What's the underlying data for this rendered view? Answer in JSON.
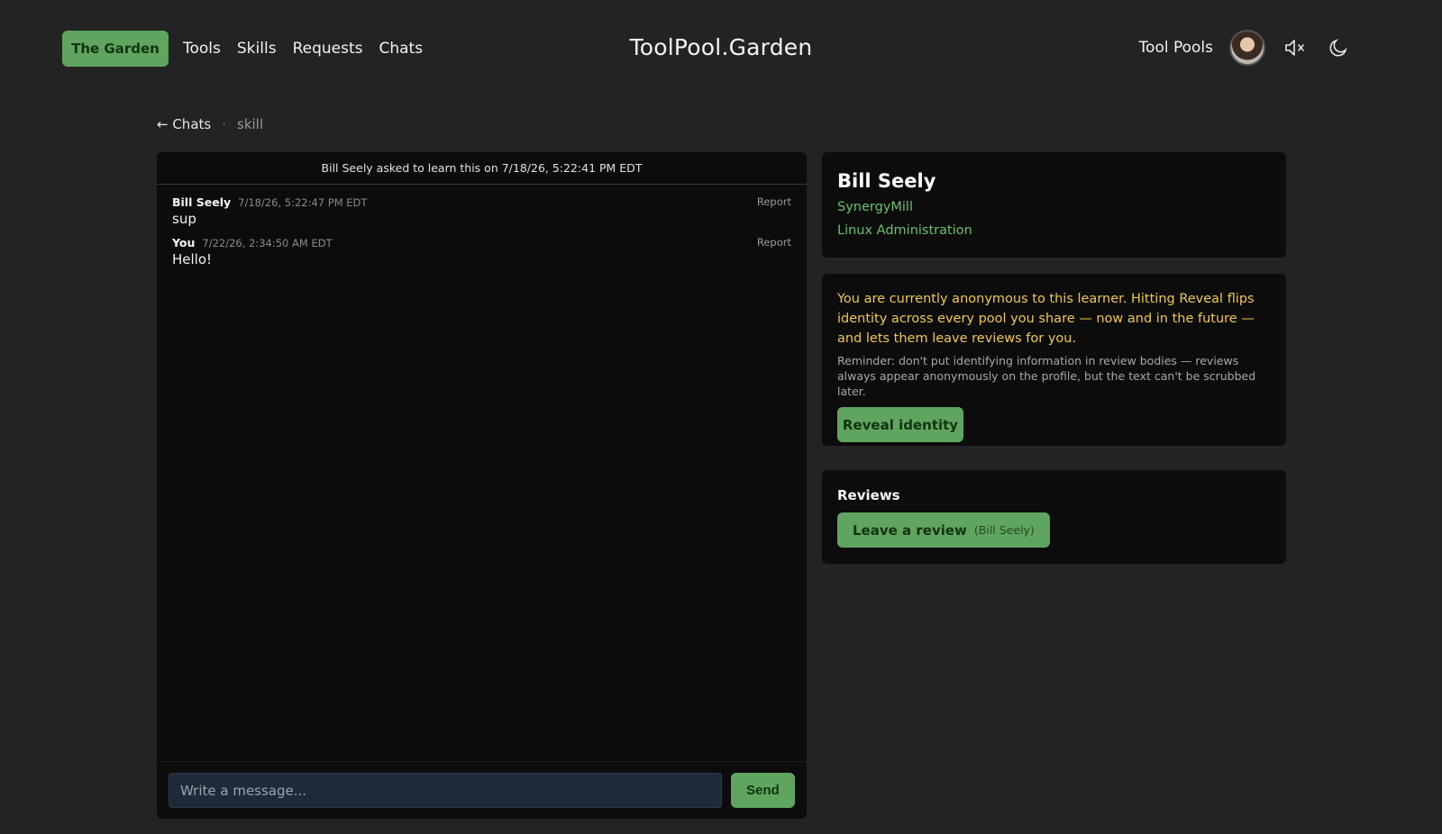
{
  "header": {
    "brand_label": "The Garden",
    "nav": [
      "Tools",
      "Skills",
      "Requests",
      "Chats"
    ],
    "site_title": "ToolPool.Garden",
    "tool_pools_label": "Tool Pools",
    "icons": [
      "avatar",
      "speaker-muted-icon",
      "moon-icon"
    ]
  },
  "breadcrumb": {
    "back_label": "← Chats",
    "separator": "·",
    "current": "skill"
  },
  "chat": {
    "header_text": "Bill Seely asked to learn this on 7/18/26, 5:22:41 PM EDT",
    "messages": [
      {
        "author": "Bill Seely",
        "time": "7/18/26, 5:22:47 PM EDT",
        "body": "sup",
        "report_label": "Report"
      },
      {
        "author": "You",
        "time": "7/22/26, 2:34:50 AM EDT",
        "body": "Hello!",
        "report_label": "Report"
      }
    ],
    "input_placeholder": "Write a message...",
    "send_label": "Send"
  },
  "profile": {
    "name": "Bill Seely",
    "org": "SynergyMill",
    "skill": "Linux Administration"
  },
  "anonymity": {
    "warning": "You are currently anonymous to this learner. Hitting Reveal flips identity across every pool you share — now and in the future — and lets them leave reviews for you.",
    "reminder": "Reminder: don't put identifying information in review bodies — reviews always appear anonymously on the profile, but the text can't be scrubbed later.",
    "reveal_label": "Reveal identity"
  },
  "reviews": {
    "title": "Reviews",
    "leave_label": "Leave a review",
    "leave_target": "(Bill Seely)"
  },
  "colors": {
    "accent": "#5fa55f",
    "link": "#6cc06c",
    "warning": "#f1c84a",
    "background": "#232323",
    "panel": "#0c0c0c"
  }
}
